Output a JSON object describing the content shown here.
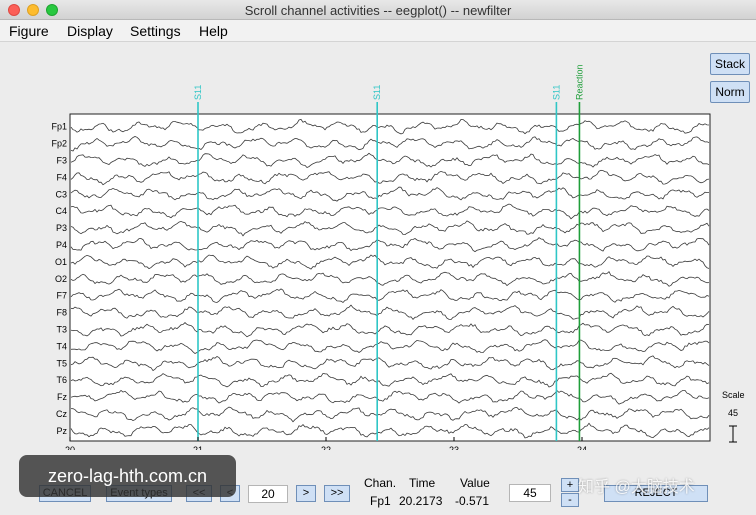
{
  "window": {
    "title": "Scroll channel activities -- eegplot() -- newfilter"
  },
  "menu": [
    "Figure",
    "Display",
    "Settings",
    "Help"
  ],
  "side_buttons": {
    "stack": "Stack",
    "norm": "Norm"
  },
  "channels": [
    "Fp1",
    "Fp2",
    "F3",
    "F4",
    "C3",
    "C4",
    "P3",
    "P4",
    "O1",
    "O2",
    "F7",
    "F8",
    "T3",
    "T4",
    "T5",
    "T6",
    "Fz",
    "Cz",
    "Pz"
  ],
  "time_ticks": [
    "20",
    "21",
    "22",
    "23",
    "24"
  ],
  "time_axis": {
    "start": 20,
    "end": 25
  },
  "events": [
    {
      "label": "S11",
      "time": 21.0,
      "color": "#2fc6c6"
    },
    {
      "label": "S11",
      "time": 22.4,
      "color": "#2fc6c6"
    },
    {
      "label": "S11",
      "time": 23.8,
      "color": "#2fc6c6"
    },
    {
      "label": "Reaction",
      "time": 23.98,
      "color": "#1f9e3a"
    }
  ],
  "scale": {
    "label": "Scale",
    "value": "45"
  },
  "controls": {
    "cancel": "CANCEL",
    "event_types": "Event types",
    "rewind": "<<",
    "back": "<",
    "window_length": "20",
    "forward": ">",
    "fast_forward": ">>",
    "chan_header": "Chan.",
    "time_header": "Time",
    "value_header": "Value",
    "chan_value": "Fp1",
    "time_value": "20.2173",
    "value_value": "-0.571",
    "scale_field": "45",
    "plus": "+",
    "minus": "-",
    "reject": "REJECT"
  },
  "overlay_text": "zero-lag-hth.com.cn",
  "watermark": "知乎 @大脑技术"
}
